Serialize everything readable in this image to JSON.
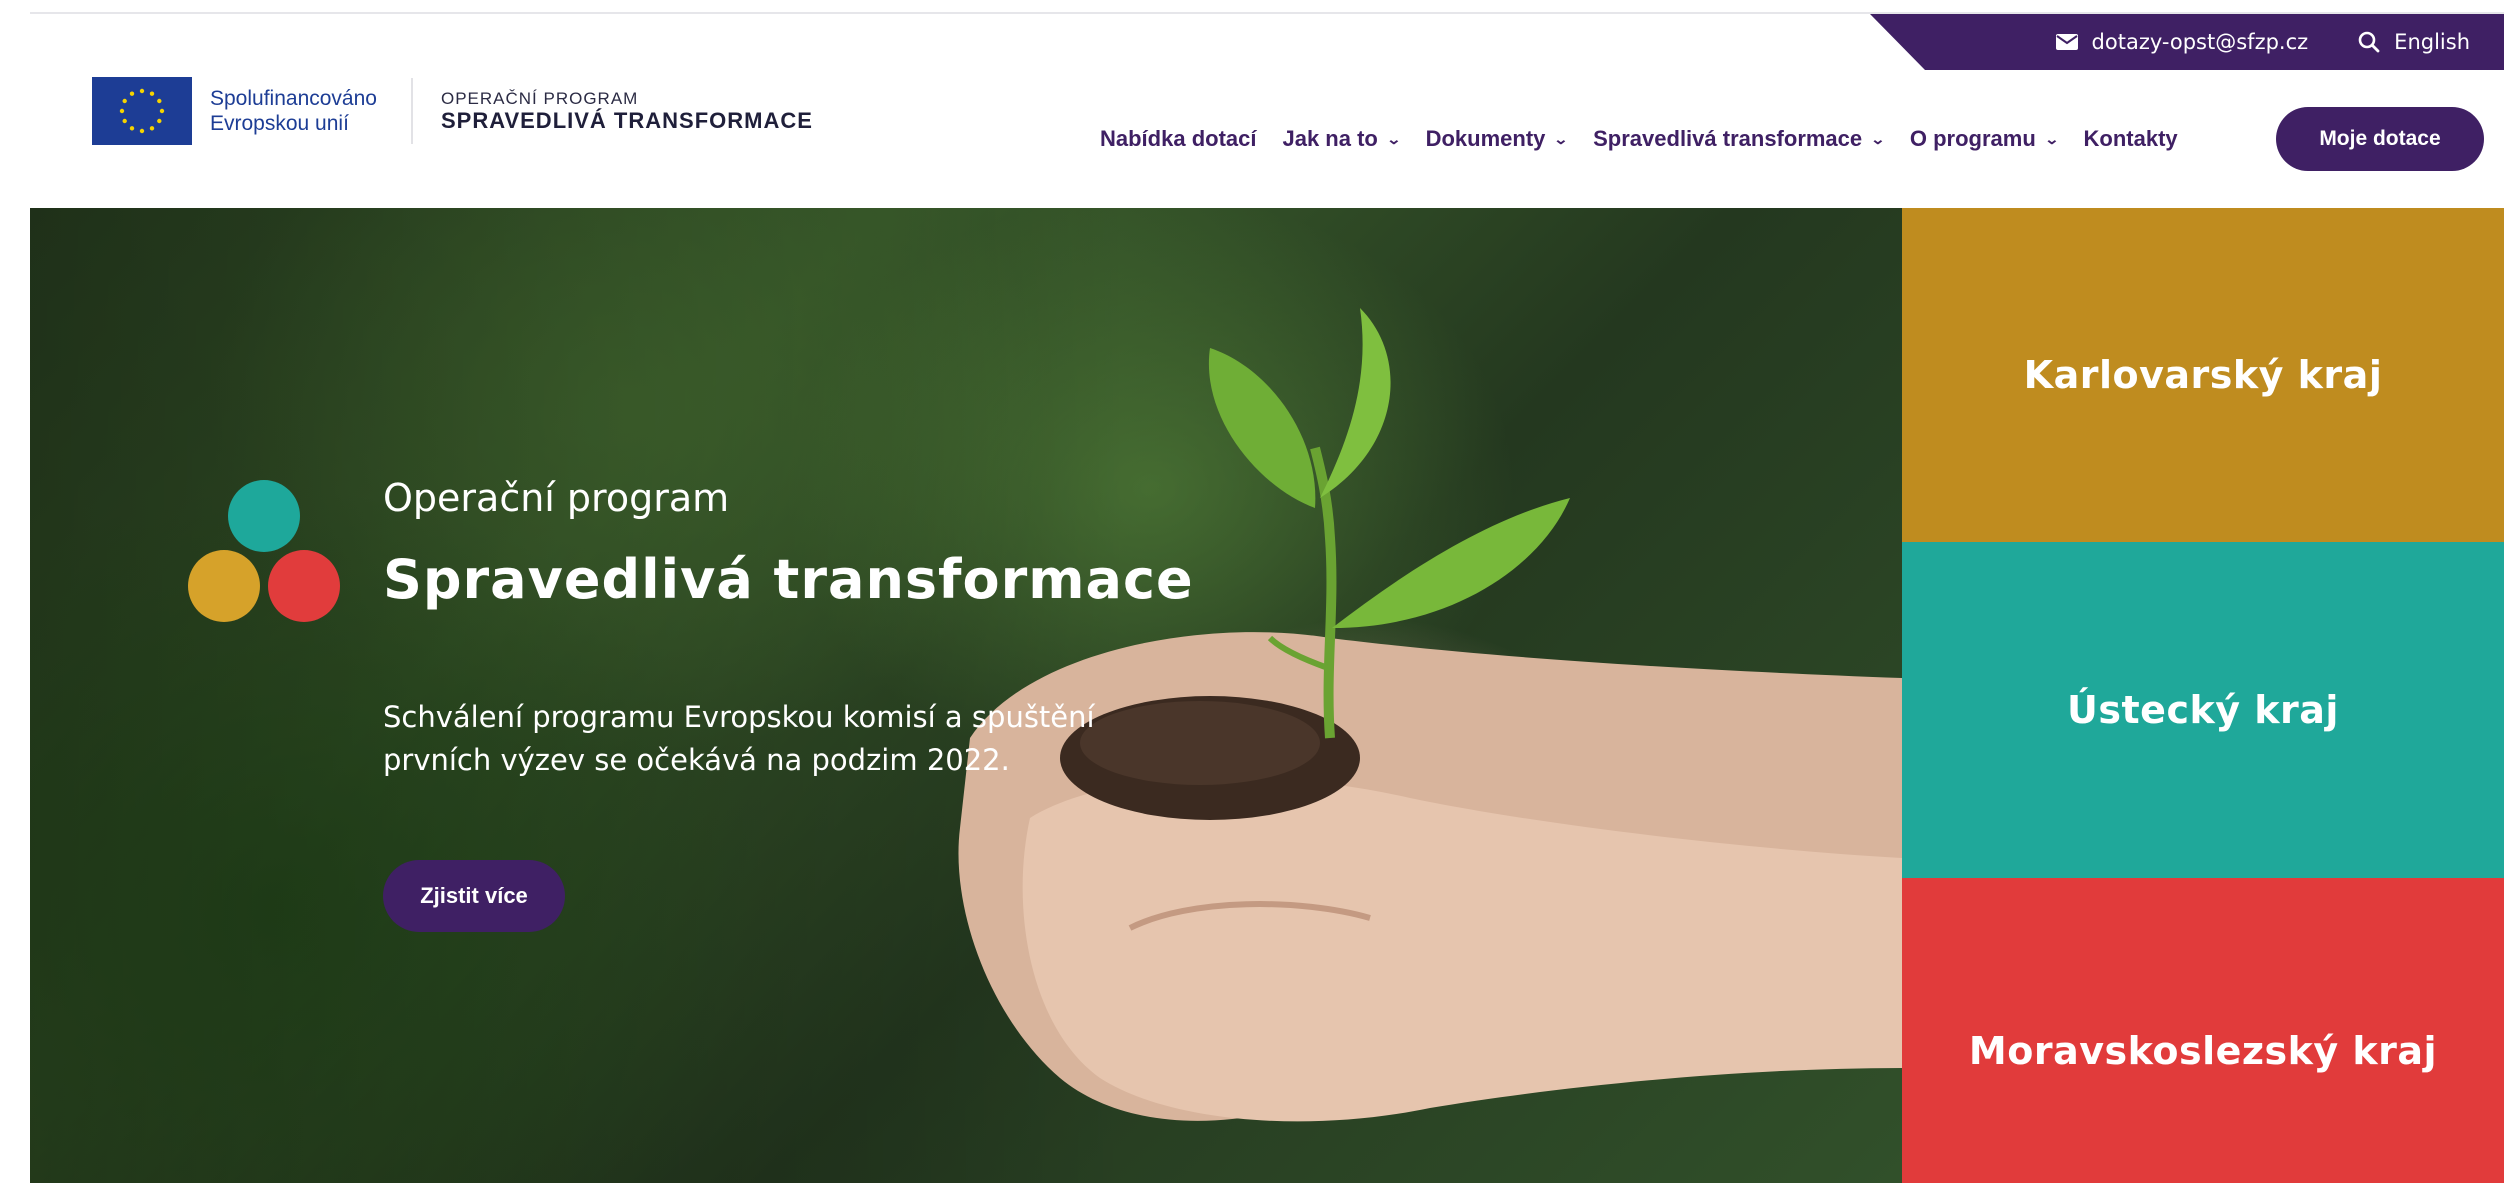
{
  "utility": {
    "email": "dotazy-opst@sfzp.cz",
    "language": "English"
  },
  "logo": {
    "eu_line1": "Spolufinancováno",
    "eu_line2": "Evropskou unií",
    "program_small": "OPERAČNÍ PROGRAM",
    "program_big": "SPRAVEDLIVÁ TRANSFORMACE"
  },
  "nav": {
    "items": [
      {
        "label": "Nabídka dotací",
        "dropdown": false
      },
      {
        "label": "Jak na to",
        "dropdown": true
      },
      {
        "label": "Dokumenty",
        "dropdown": true
      },
      {
        "label": "Spravedlivá transformace",
        "dropdown": true
      },
      {
        "label": "O programu",
        "dropdown": true
      },
      {
        "label": "Kontakty",
        "dropdown": false
      }
    ],
    "cta": "Moje dotace"
  },
  "hero": {
    "kicker": "Operační program",
    "title": "Spravedlivá transformace",
    "description": "Schválení programu Evropskou komisí a spuštění prvních výzev se očekává na podzim 2022.",
    "button": "Zjistit více"
  },
  "regions": [
    {
      "label": "Karlovarský kraj",
      "color": "#bf8c1f"
    },
    {
      "label": "Ústecký kraj",
      "color": "#1fa89a"
    },
    {
      "label": "Moravskoslezský kraj",
      "color": "#e13b3b"
    }
  ],
  "colors": {
    "brand_purple": "#3f2064",
    "eu_blue": "#1d3d95",
    "dot_teal": "#1ea89b",
    "dot_gold": "#d6a22a",
    "dot_red": "#e13c3c"
  },
  "icons": {
    "email": "envelope-icon",
    "search": "search-icon",
    "dropdown": "chevron-down-icon",
    "eu": "eu-flag-icon",
    "logo": "three-dots-logo"
  }
}
